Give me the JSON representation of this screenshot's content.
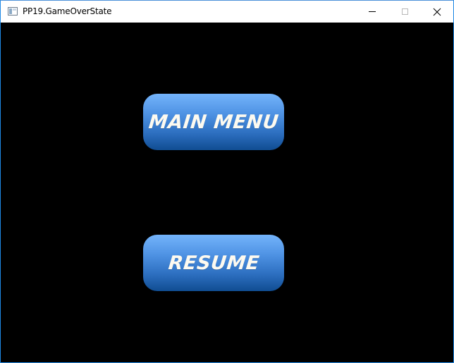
{
  "window": {
    "title": "PP19.GameOverState",
    "icon": "app-window-icon",
    "controls": {
      "minimize_icon": "minimize-icon",
      "maximize_icon": "maximize-icon",
      "close_icon": "close-icon"
    }
  },
  "game": {
    "background_color": "#000000",
    "buttons": [
      {
        "label": "MAIN MENU"
      },
      {
        "label": "RESUME"
      }
    ],
    "button_colors": {
      "top": "#74b4fb",
      "bottom": "#104d92",
      "text": "#fdfaf0"
    }
  }
}
